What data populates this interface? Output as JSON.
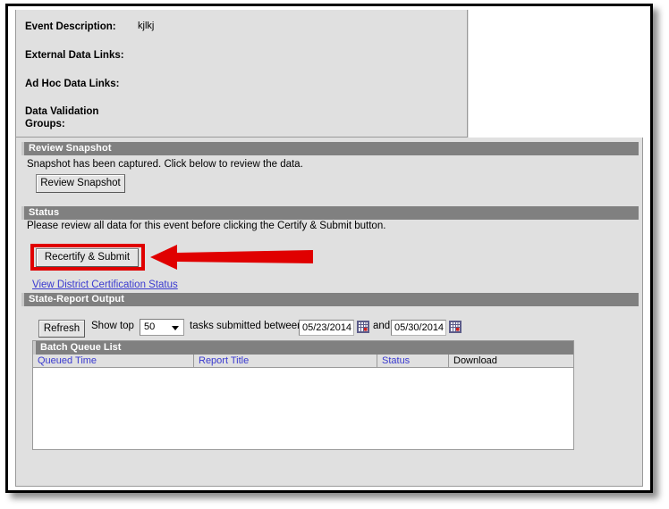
{
  "detail": {
    "rows": [
      {
        "label": "Event Description:",
        "value": "kjlkj"
      },
      {
        "label": "External Data Links:",
        "value": ""
      },
      {
        "label": "Ad Hoc Data Links:",
        "value": ""
      },
      {
        "label": "Data Validation",
        "value": ""
      },
      {
        "label": "Groups:",
        "value": ""
      }
    ]
  },
  "review_snapshot": {
    "header": "Review Snapshot",
    "description": "Snapshot has been captured. Click below to review the data.",
    "button_label": "Review Snapshot"
  },
  "status": {
    "header": "Status",
    "description": "Please review all data for this event before clicking the Certify & Submit button.",
    "button_label": "Recertify & Submit",
    "link_label": "View District Certification Status",
    "highlight_color": "#e00000"
  },
  "state_report_output": {
    "header": "State-Report Output",
    "refresh_label": "Refresh",
    "show_top_label": "Show top",
    "show_top_value": "50",
    "show_top_options": [
      "50"
    ],
    "tasks_label": "tasks submitted between",
    "start_date": "05/23/2014",
    "and_label": "and",
    "end_date": "05/30/2014",
    "start_calendar_icon": "calendar-icon",
    "end_calendar_icon": "calendar-icon"
  },
  "batch_queue": {
    "title": "Batch Queue List",
    "columns": [
      {
        "label": "Queued Time",
        "sortable": true
      },
      {
        "label": "Report Title",
        "sortable": true
      },
      {
        "label": "Status",
        "sortable": true
      },
      {
        "label": "Download",
        "sortable": false
      }
    ],
    "rows": []
  }
}
